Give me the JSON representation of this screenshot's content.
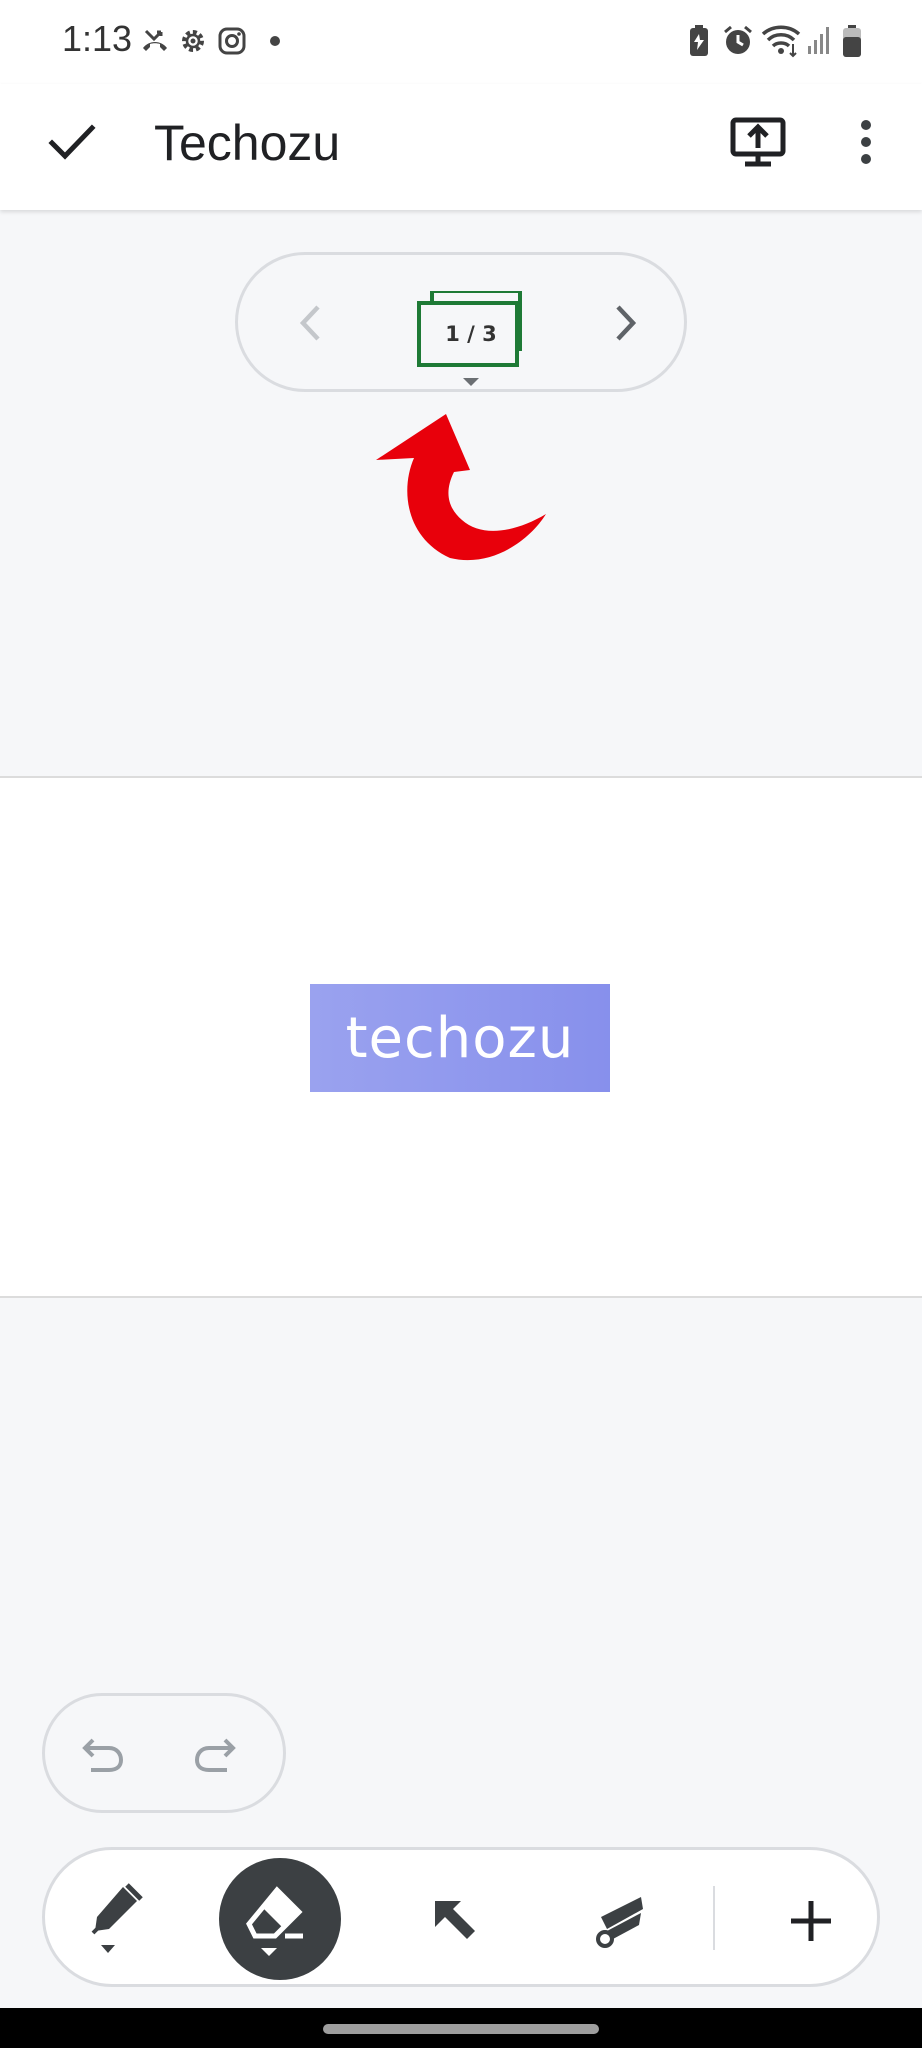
{
  "status_bar": {
    "time": "1:13",
    "left_icons": [
      "missed-call-icon",
      "settings-icon",
      "instagram-icon",
      "notification-dot-icon"
    ],
    "right_icons": [
      "battery-saver-icon",
      "alarm-icon",
      "wifi-icon",
      "signal-icon",
      "battery-icon"
    ]
  },
  "app_bar": {
    "title": "Techozu",
    "done_icon": "check-icon",
    "present_icon": "present-to-screen-icon",
    "menu_icon": "more-vert-icon"
  },
  "page_nav": {
    "counter": "1 / 3",
    "prev_icon": "chevron-left-icon",
    "next_icon": "chevron-right-icon",
    "dropdown_icon": "dropdown-arrow-icon"
  },
  "annotation": {
    "arrow_color": "#e8000b"
  },
  "slide": {
    "logo_text": "techozu",
    "logo_color": "#8b93ed"
  },
  "history": {
    "undo_icon": "undo-icon",
    "redo_icon": "redo-icon"
  },
  "toolbar": {
    "tools": [
      "pen-icon",
      "eraser-icon",
      "select-arrow-icon",
      "laser-pointer-icon",
      "add-icon"
    ],
    "active_tool": "eraser-icon"
  }
}
